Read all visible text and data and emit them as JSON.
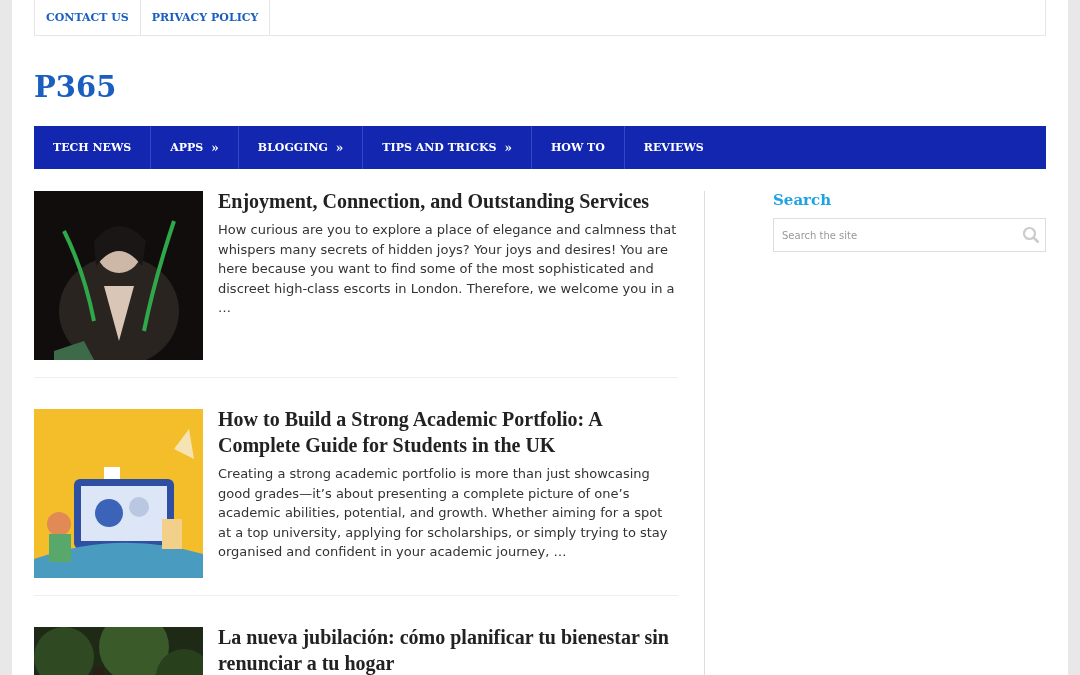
{
  "top_menu": [
    {
      "label": "CONTACT US"
    },
    {
      "label": "PRIVACY POLICY"
    }
  ],
  "site_title": "P365",
  "nav": [
    {
      "label": "TECH NEWS"
    },
    {
      "label": "APPS",
      "arrow": "»"
    },
    {
      "label": "BLOGGING",
      "arrow": "»"
    },
    {
      "label": "TIPS AND TRICKS",
      "arrow": "»"
    },
    {
      "label": "HOW TO"
    },
    {
      "label": "REVIEWS"
    }
  ],
  "posts": [
    {
      "title": "Enjoyment, Connection, and Outstanding Services",
      "excerpt": "How curious are you to explore a place of elegance and calmness that whispers many secrets of hidden joys? Your joys and desires! You are here because you want to find some of the most sophisticated and discreet high-class escorts in London. Therefore, we welcome you in a …"
    },
    {
      "title": "How to Build a Strong Academic Portfolio: A Complete Guide for Students in the UK",
      "excerpt": "Creating a strong academic portfolio is more than just showcasing good grades—it’s about presenting a complete picture of one’s academic abilities, potential, and growth. Whether aiming for a spot at a top university, applying for scholarships, or simply trying to stay organised and confident in your academic journey, …"
    },
    {
      "title": "La nueva jubilación: cómo planificar tu bienestar sin renunciar a tu hogar"
    }
  ],
  "sidebar": {
    "search_title": "Search",
    "search": {
      "placeholder": "Search the site"
    }
  }
}
